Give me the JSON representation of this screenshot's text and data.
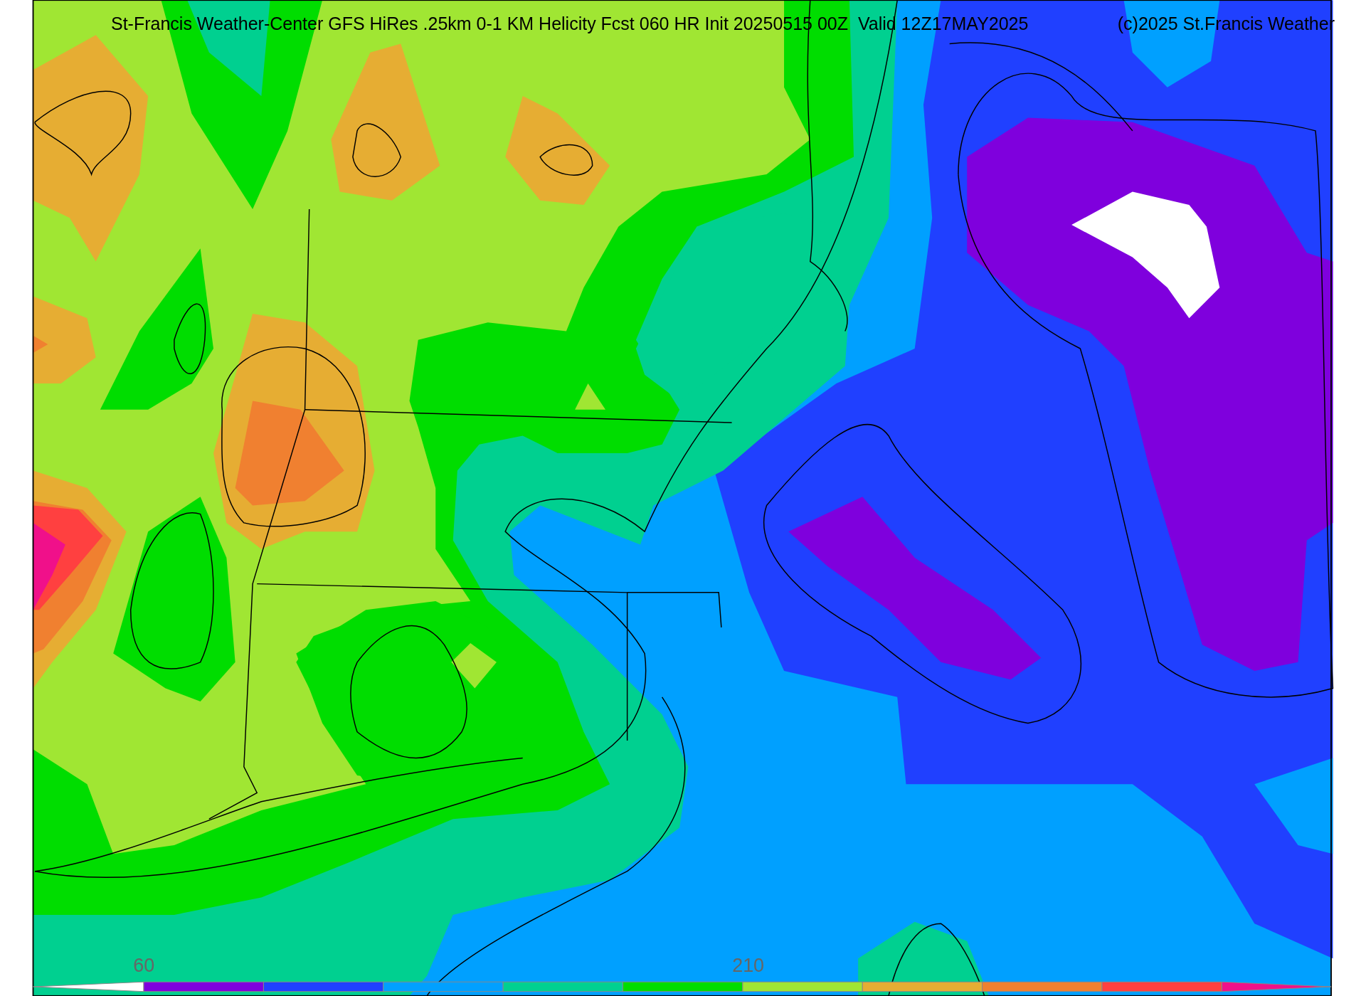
{
  "title": "St-Francis Weather-Center GFS HiRes .25km 0-1 KM Helicity Fcst 060 HR Init 20250515 00Z  Valid 12Z17MAY2025",
  "credit": "(c)2025 St.Francis Weather",
  "colorbar": {
    "low_extend": {
      "color": "#ffffff"
    },
    "high_extend": {
      "color": "#f0108a"
    },
    "segments": [
      {
        "color": "#7f00dd",
        "label": "60"
      },
      {
        "color": "#2040ff"
      },
      {
        "color": "#00a0ff"
      },
      {
        "color": "#00d090"
      },
      {
        "color": "#00dd00"
      },
      {
        "color": "#a0e633",
        "label": "210"
      },
      {
        "color": "#e6ad33"
      },
      {
        "color": "#f08030"
      },
      {
        "color": "#ff4040"
      }
    ]
  }
}
